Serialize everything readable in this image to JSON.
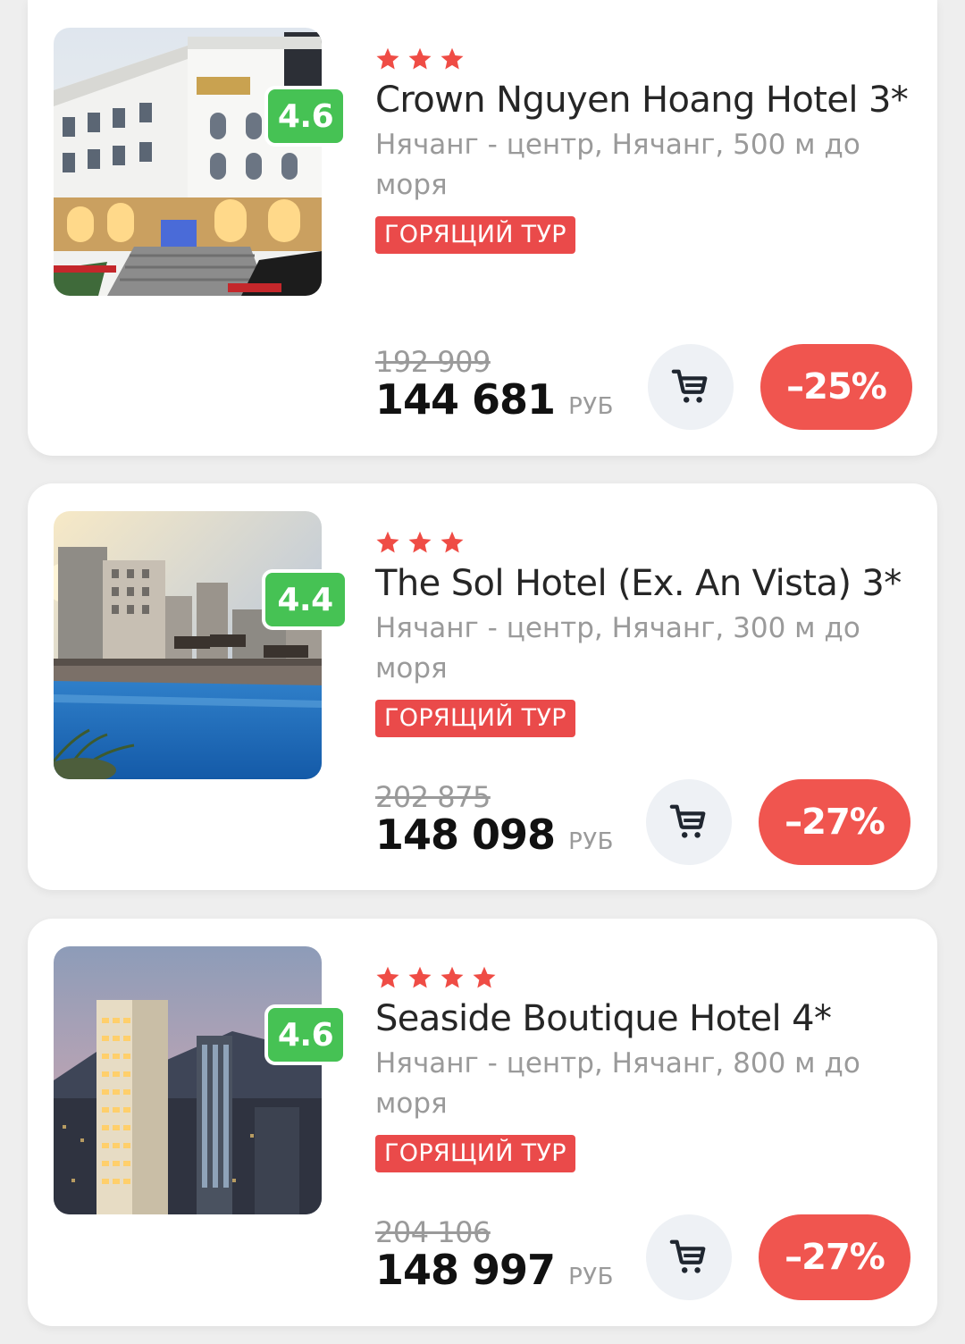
{
  "colors": {
    "accent_red": "#f0554f",
    "rating_green": "#46c254",
    "hot_badge": "#ea4a4a",
    "star": "#ef4c45"
  },
  "hotels": [
    {
      "rating": "4.6",
      "stars": 3,
      "title": "Crown Nguyen Hoang Hotel 3*",
      "location": "Нячанг - центр, Нячанг, 500 м до моря",
      "badge": "ГОРЯЩИЙ ТУР",
      "old_price": "192 909",
      "price": "144 681",
      "currency": "РУБ",
      "discount": "–25%",
      "cart_icon": "cart-icon"
    },
    {
      "rating": "4.4",
      "stars": 3,
      "title": "The Sol Hotel (Ex. An Vista) 3*",
      "location": "Нячанг - центр, Нячанг, 300 м до моря",
      "badge": "ГОРЯЩИЙ ТУР",
      "old_price": "202 875",
      "price": "148 098",
      "currency": "РУБ",
      "discount": "–27%",
      "cart_icon": "cart-icon"
    },
    {
      "rating": "4.6",
      "stars": 4,
      "title": "Seaside Boutique Hotel 4*",
      "location": "Нячанг - центр, Нячанг, 800 м до моря",
      "badge": "ГОРЯЩИЙ ТУР",
      "old_price": "204 106",
      "price": "148 997",
      "currency": "РУБ",
      "discount": "–27%",
      "cart_icon": "cart-icon"
    }
  ]
}
